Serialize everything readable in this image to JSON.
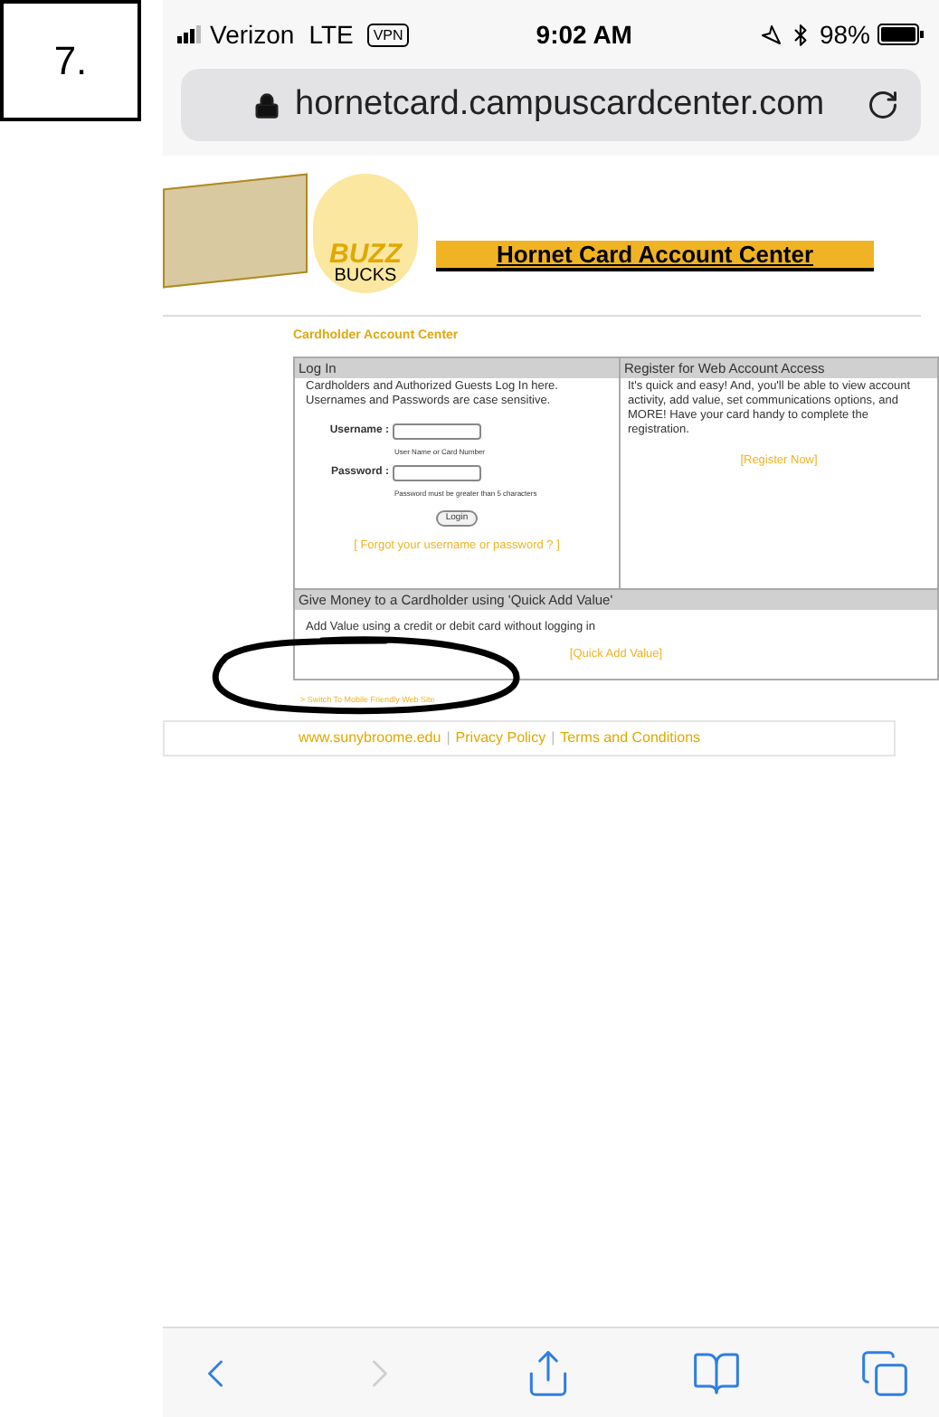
{
  "label": "7.",
  "status_bar": {
    "carrier": "Verizon",
    "network": "LTE",
    "vpn": "VPN",
    "time": "9:02 AM",
    "battery": "98%"
  },
  "address_bar": {
    "url": "hornetcard.campuscardcenter.com"
  },
  "page": {
    "logo": {
      "buzz": "BUZZ",
      "bucks": "BUCKS"
    },
    "banner": "Hornet Card Account Center",
    "section_title": "Cardholder Account Center",
    "login": {
      "title": "Log In",
      "intro": "Cardholders and Authorized Guests Log In here. Usernames and Passwords are case sensitive.",
      "fields": [
        {
          "label": "Username :",
          "hint": "User Name or Card Number"
        },
        {
          "label": "Password :",
          "hint": "Password must be greater than 5 characters"
        }
      ],
      "button": "Login",
      "forgot_link": "[ Forgot your username or password ? ]"
    },
    "register": {
      "title": "Register for Web Account Access",
      "text": "It's quick and easy! And, you'll be able to view account activity, add value, set communications options, and MORE! Have your card handy to complete the registration.",
      "link": "[Register Now]"
    },
    "quick_add": {
      "title": "Give Money to a Cardholder using 'Quick Add Value'",
      "text": "Add Value using a credit or debit card without logging in",
      "link": "[Quick Add Value]"
    },
    "mobile_link": "> Switch To Mobile Friendly Web Site",
    "footer_links": [
      "www.sunybroome.edu",
      "Privacy Policy",
      "Terms and Conditions"
    ],
    "footer_separator": "|"
  },
  "toolbar": [
    {
      "kind": "back",
      "disabled": false
    },
    {
      "kind": "forward",
      "disabled": true
    },
    {
      "kind": "share",
      "disabled": false
    },
    {
      "kind": "bookmarks",
      "disabled": false
    },
    {
      "kind": "tabs",
      "disabled": false
    }
  ]
}
